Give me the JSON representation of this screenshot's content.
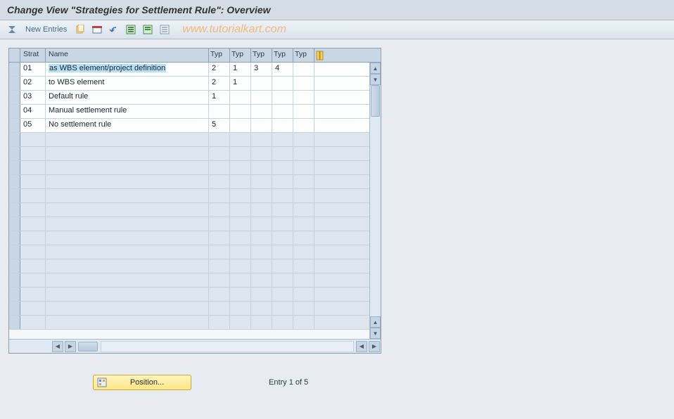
{
  "title": "Change View \"Strategies for Settlement Rule\": Overview",
  "toolbar": {
    "new_entries_label": "New Entries"
  },
  "watermark": "www.tutorialkart.com",
  "table": {
    "headers": {
      "strat": "Strat",
      "name": "Name",
      "typ1": "Typ",
      "typ2": "Typ",
      "typ3": "Typ",
      "typ4": "Typ",
      "typ5": "Typ"
    },
    "rows": [
      {
        "strat": "01",
        "name": "as WBS element/project definition",
        "t1": "2",
        "t2": "1",
        "t3": "3",
        "t4": "4",
        "t5": "",
        "selected": true
      },
      {
        "strat": "02",
        "name": "to WBS element",
        "t1": "2",
        "t2": "1",
        "t3": "",
        "t4": "",
        "t5": ""
      },
      {
        "strat": "03",
        "name": "Default rule",
        "t1": "1",
        "t2": "",
        "t3": "",
        "t4": "",
        "t5": ""
      },
      {
        "strat": "04",
        "name": "Manual settlement rule",
        "t1": "",
        "t2": "",
        "t3": "",
        "t4": "",
        "t5": ""
      },
      {
        "strat": "05",
        "name": "No settlement rule",
        "t1": "5",
        "t2": "",
        "t3": "",
        "t4": "",
        "t5": ""
      }
    ],
    "empty_row_count": 14
  },
  "footer": {
    "position_label": "Position...",
    "entry_status": "Entry 1 of 5"
  },
  "colors": {
    "accent_blue": "#b8e0f5",
    "panel_bg": "#e8ecf0",
    "button_yellow": "#ffe783"
  }
}
